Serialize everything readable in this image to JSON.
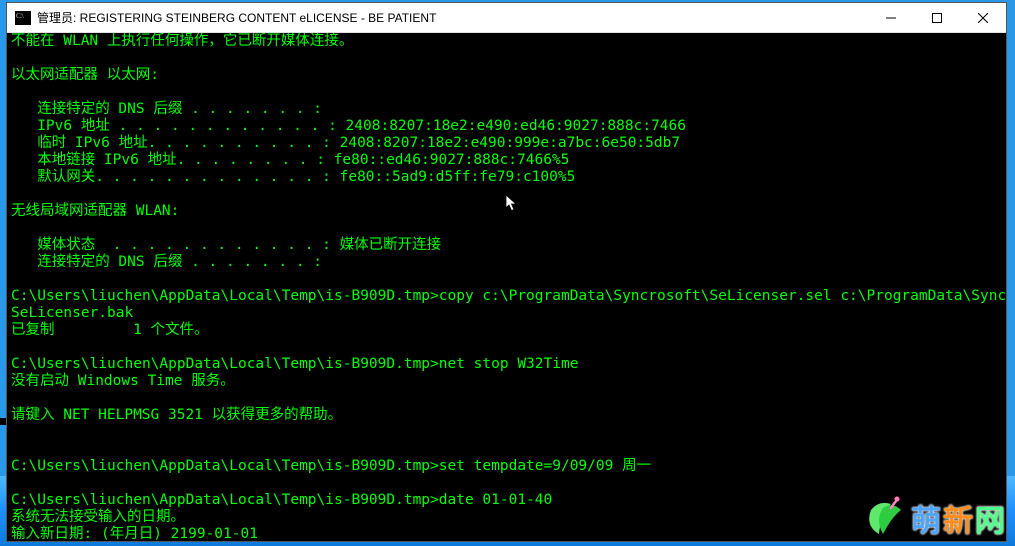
{
  "titlebar": {
    "title": "管理员:  REGISTERING STEINBERG CONTENT eLICENSE - BE PATIENT"
  },
  "terminal": {
    "lines": [
      "不能在 WLAN 上执行任何操作，它已断开媒体连接。",
      "",
      "以太网适配器 以太网:",
      "",
      "   连接特定的 DNS 后缀 . . . . . . . :",
      "   IPv6 地址 . . . . . . . . . . . . : 2408:8207:18e2:e490:ed46:9027:888c:7466",
      "   临时 IPv6 地址. . . . . . . . . . : 2408:8207:18e2:e490:999e:a7bc:6e50:5db7",
      "   本地链接 IPv6 地址. . . . . . . . : fe80::ed46:9027:888c:7466%5",
      "   默认网关. . . . . . . . . . . . . : fe80::5ad9:d5ff:fe79:c100%5",
      "",
      "无线局域网适配器 WLAN:",
      "",
      "   媒体状态  . . . . . . . . . . . . : 媒体已断开连接",
      "   连接特定的 DNS 后缀 . . . . . . . :",
      "",
      "C:\\Users\\liuchen\\AppData\\Local\\Temp\\is-B909D.tmp>copy c:\\ProgramData\\Syncrosoft\\SeLicenser.sel c:\\ProgramData\\Syncrosoft\\SeLicenser.bak",
      "已复制         1 个文件。",
      "",
      "C:\\Users\\liuchen\\AppData\\Local\\Temp\\is-B909D.tmp>net stop W32Time",
      "没有启动 Windows Time 服务。",
      "",
      "请键入 NET HELPMSG 3521 以获得更多的帮助。",
      "",
      "",
      "C:\\Users\\liuchen\\AppData\\Local\\Temp\\is-B909D.tmp>set tempdate=9/09/09 周一",
      "",
      "C:\\Users\\liuchen\\AppData\\Local\\Temp\\is-B909D.tmp>date 01-01-40",
      "系统无法接受输入的日期。",
      "输入新日期: (年月日) 2199-01-01"
    ]
  },
  "watermark": {
    "c1": "萌",
    "c2": "新",
    "c3": "网"
  }
}
